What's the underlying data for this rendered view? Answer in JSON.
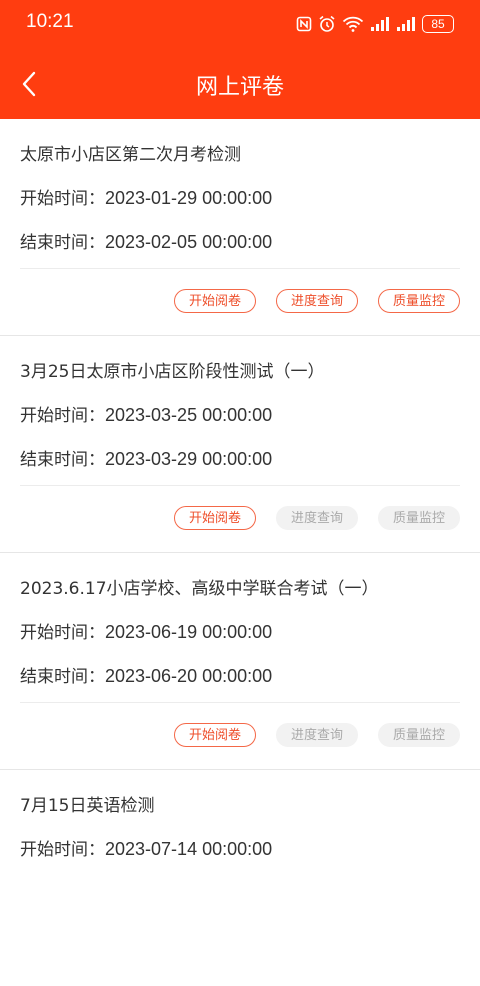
{
  "status_bar": {
    "time": "10:21",
    "battery": "85"
  },
  "header": {
    "title": "网上评卷"
  },
  "labels": {
    "start": "开始时间：",
    "end": "结束时间："
  },
  "colors": {
    "accent": "#ff3d10",
    "button_active_text": "#ee4f2b",
    "button_disabled_bg": "#f2f2f2"
  },
  "exams": [
    {
      "title": "太原市小店区第二次月考检测",
      "start": "2023-01-29 00:00:00",
      "end": "2023-02-05 00:00:00",
      "buttons": [
        {
          "label": "开始阅卷",
          "enabled": true
        },
        {
          "label": "进度查询",
          "enabled": true
        },
        {
          "label": "质量监控",
          "enabled": true
        }
      ]
    },
    {
      "title": "3月25日太原市小店区阶段性测试（一）",
      "start": "2023-03-25 00:00:00",
      "end": "2023-03-29 00:00:00",
      "buttons": [
        {
          "label": "开始阅卷",
          "enabled": true
        },
        {
          "label": "进度查询",
          "enabled": false
        },
        {
          "label": "质量监控",
          "enabled": false
        }
      ]
    },
    {
      "title": "2023.6.17小店学校、高级中学联合考试（一）",
      "start": "2023-06-19 00:00:00",
      "end": "2023-06-20 00:00:00",
      "buttons": [
        {
          "label": "开始阅卷",
          "enabled": true
        },
        {
          "label": "进度查询",
          "enabled": false
        },
        {
          "label": "质量监控",
          "enabled": false
        }
      ]
    },
    {
      "title": "7月15日英语检测",
      "start": "2023-07-14 00:00:00"
    }
  ]
}
